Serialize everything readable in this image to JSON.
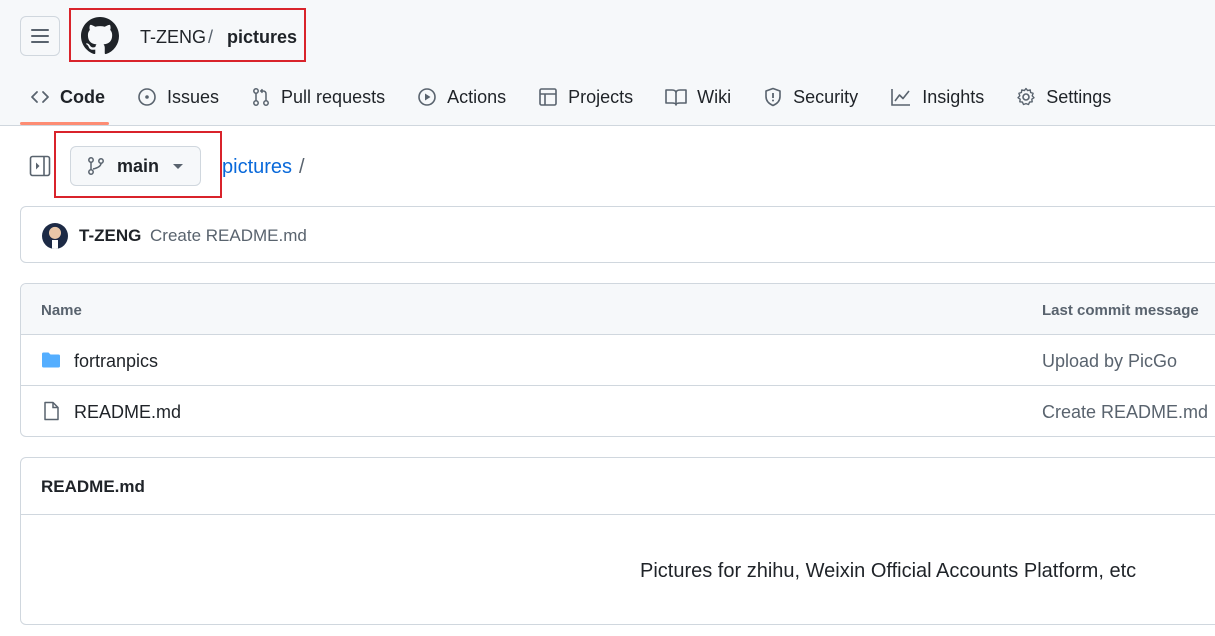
{
  "header": {
    "owner": "T-ZENG",
    "separator": "/",
    "repo": "pictures"
  },
  "tabs": [
    {
      "label": "Code",
      "icon": "code-icon",
      "active": true
    },
    {
      "label": "Issues",
      "icon": "issue-icon"
    },
    {
      "label": "Pull requests",
      "icon": "pull-request-icon"
    },
    {
      "label": "Actions",
      "icon": "play-icon"
    },
    {
      "label": "Projects",
      "icon": "table-icon"
    },
    {
      "label": "Wiki",
      "icon": "book-icon"
    },
    {
      "label": "Security",
      "icon": "shield-icon"
    },
    {
      "label": "Insights",
      "icon": "graph-icon"
    },
    {
      "label": "Settings",
      "icon": "gear-icon"
    }
  ],
  "branch": {
    "name": "main",
    "path_repo": "pictures",
    "path_sep": "/"
  },
  "commit": {
    "author": "T-ZENG",
    "message": "Create README.md"
  },
  "files": {
    "headers": {
      "name": "Name",
      "message": "Last commit message"
    },
    "rows": [
      {
        "name": "fortranpics",
        "type": "folder",
        "message": "Upload by PicGo"
      },
      {
        "name": "README.md",
        "type": "file",
        "message": "Create README.md"
      }
    ]
  },
  "readme": {
    "title": "README.md",
    "body": "Pictures for zhihu, Weixin Official Accounts Platform, etc"
  },
  "colors": {
    "accent_underline": "#fd8c73",
    "link": "#0969da",
    "folder": "#54aeff",
    "highlight_box": "#d9232b"
  }
}
